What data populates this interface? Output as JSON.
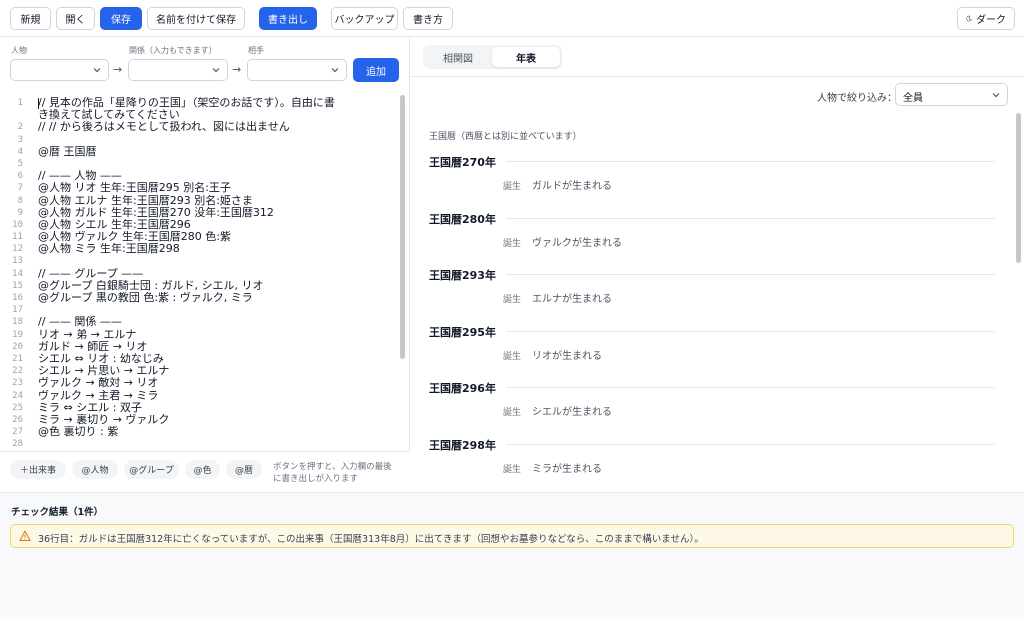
{
  "toolbar": {
    "new": "新規",
    "open": "開く",
    "save": "保存",
    "save_as": "名前を付けて保存",
    "export": "書き出し",
    "backup": "バックアップ",
    "howto": "書き方",
    "dark": "ダーク"
  },
  "relation_form": {
    "person_label": "人物",
    "relation_label": "関係（入力もできます）",
    "partner_label": "相手",
    "arrow": "→",
    "add": "追加"
  },
  "editor": {
    "line_numbers": [
      "1",
      "",
      "2",
      "3",
      "4",
      "5",
      "6",
      "7",
      "8",
      "9",
      "10",
      "11",
      "12",
      "13",
      "14",
      "15",
      "16",
      "17",
      "18",
      "19",
      "20",
      "21",
      "22",
      "23",
      "24",
      "25",
      "26",
      "27",
      "28"
    ],
    "lines": [
      "// 見本の作品「星降りの王国」（架空のお話です）。自由に書",
      "き換えて試してみてください",
      "// // から後ろはメモとして扱われ、図には出ません",
      "",
      "@暦 王国暦",
      "",
      "// —— 人物 ——",
      "@人物 リオ 生年:王国暦295 別名:王子",
      "@人物 エルナ 生年:王国暦293 別名:姫さま",
      "@人物 ガルド 生年:王国暦270 没年:王国暦312",
      "@人物 シエル 生年:王国暦296",
      "@人物 ヴァルク 生年:王国暦280 色:紫",
      "@人物 ミラ 生年:王国暦298",
      "",
      "// —— グループ ——",
      "@グループ 白銀騎士団 : ガルド, シエル, リオ",
      "@グループ 黒の教団 色:紫 : ヴァルク, ミラ",
      "",
      "// —— 関係 ——",
      "リオ → 弟 → エルナ",
      "ガルド → 師匠 → リオ",
      "シエル ⇔ リオ : 幼なじみ",
      "シエル → 片思い → エルナ",
      "ヴァルク → 敵対 → リオ",
      "ヴァルク → 主君 → ミラ",
      "ミラ ⇔ シエル : 双子",
      "ミラ → 裏切り → ヴァルク",
      "@色 裏切り : 紫",
      ""
    ]
  },
  "chips": {
    "event": "＋出来事",
    "person": "@人物",
    "group": "@グループ",
    "color": "@色",
    "calendar": "@暦",
    "hint_line1": "ボタンを押すと、入力欄の最後",
    "hint_line2": "に書き出しが入ります"
  },
  "view_tabs": {
    "graph": "相関図",
    "timeline": "年表"
  },
  "filter": {
    "label": "人物で絞り込み：",
    "value": "全員"
  },
  "timeline": {
    "calendar_note": "王国暦（西暦とは別に並べています）",
    "entries": [
      {
        "year": "王国暦270年",
        "kind": "誕生",
        "text": "ガルドが生まれる"
      },
      {
        "year": "王国暦280年",
        "kind": "誕生",
        "text": "ヴァルクが生まれる"
      },
      {
        "year": "王国暦293年",
        "kind": "誕生",
        "text": "エルナが生まれる"
      },
      {
        "year": "王国暦295年",
        "kind": "誕生",
        "text": "リオが生まれる"
      },
      {
        "year": "王国暦296年",
        "kind": "誕生",
        "text": "シエルが生まれる"
      },
      {
        "year": "王国暦298年",
        "kind": "誕生",
        "text": "ミラが生まれる"
      }
    ]
  },
  "check": {
    "title": "チェック結果（1件）",
    "warnings": [
      "36行目：ガルドは王国暦312年に亡くなっていますが、この出来事（王国暦313年8月）に出てきます（回想やお墓参りなどなら、このままで構いません）。"
    ]
  },
  "colors": {
    "accent": "#2563eb",
    "warning_bg": "#fef9e7",
    "warning_border": "#f5d36b",
    "warning_icon": "#d97706"
  }
}
